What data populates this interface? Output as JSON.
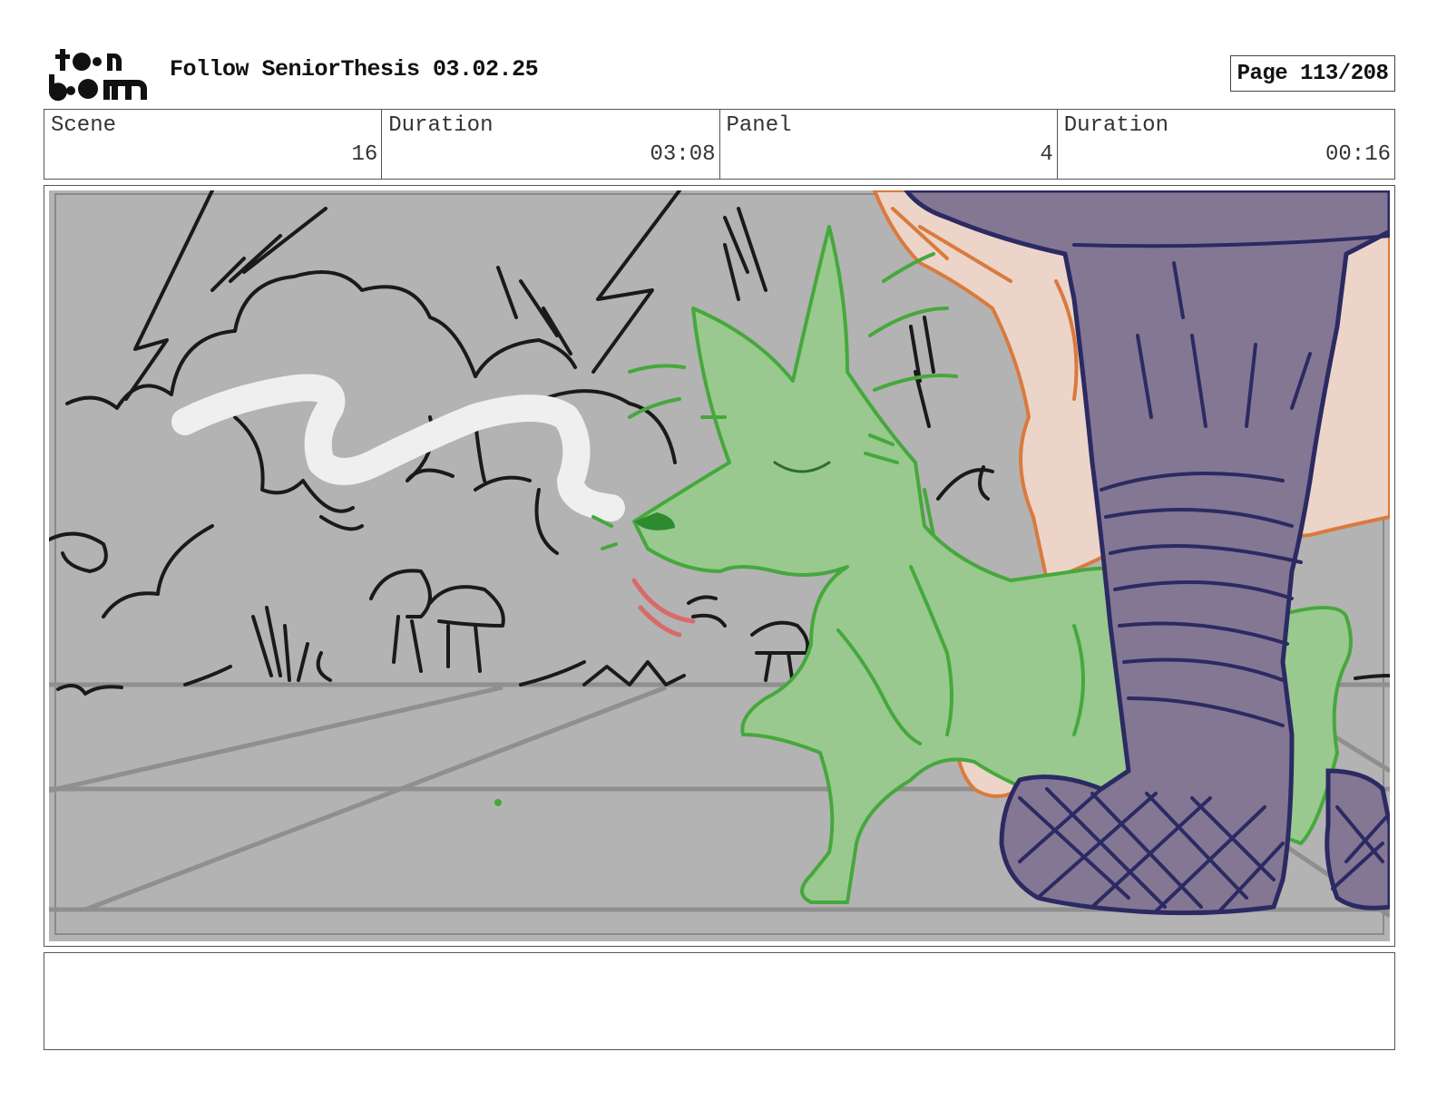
{
  "header": {
    "logo_top": "toon",
    "logo_bottom": "boom",
    "title": "Follow SeniorThesis 03.02.25",
    "page": "Page 113/208"
  },
  "info": {
    "scene_label": "Scene",
    "scene_value": "16",
    "scene_duration_label": "Duration",
    "scene_duration_value": "03:08",
    "panel_label": "Panel",
    "panel_value": "4",
    "panel_duration_label": "Duration",
    "panel_duration_value": "00:16"
  },
  "notes": {
    "text": ""
  },
  "colors": {
    "background_gray": "#b3b3b3",
    "dog_green": "#99c98f",
    "dog_outline": "#46a83c",
    "pants_purple": "#847793",
    "pants_outline": "#2c2a63",
    "skin": "#ecd4c8",
    "skin_outline": "#d97a3e",
    "smoke": "#efefef",
    "tongue": "#d96a6a"
  }
}
